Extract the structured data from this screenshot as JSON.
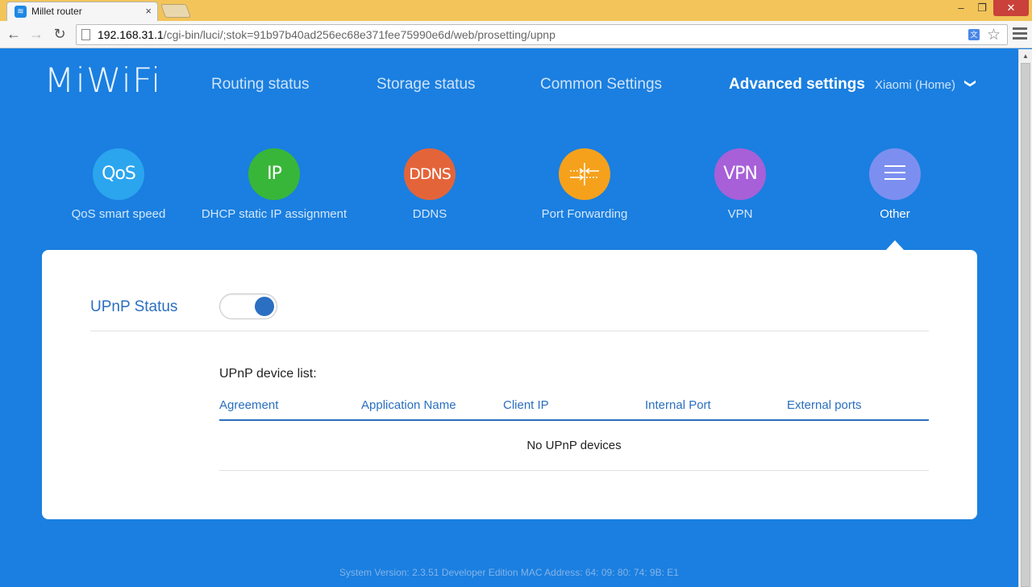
{
  "browser": {
    "tab_title": "Millet router",
    "tab_close": "×",
    "url_host": "192.168.31.1",
    "url_path": "/cgi-bin/luci/;stok=91b97b40ad256ec68e371fee75990e6d/web/prosetting/upnp",
    "window_minimize": "–",
    "window_maximize": "❐",
    "window_close": "✕",
    "back": "←",
    "forward": "→",
    "reload": "↻",
    "star": "☆"
  },
  "header": {
    "logo": "MiWiFi",
    "nav": {
      "routing": "Routing status",
      "storage": "Storage status",
      "common": "Common Settings",
      "advanced": "Advanced settings"
    },
    "router_name": "Xiaomi (Home)",
    "chevron": "❯"
  },
  "features": {
    "qos": {
      "icon_text": "QoS",
      "label": "QoS smart speed"
    },
    "ip": {
      "icon_text": "IP",
      "label": "DHCP static IP assignment"
    },
    "ddns": {
      "icon_text": "DDNS",
      "label": "DDNS"
    },
    "port_forwarding": {
      "label": "Port Forwarding"
    },
    "vpn": {
      "icon_text": "VPN",
      "label": "VPN"
    },
    "other": {
      "label": "Other"
    }
  },
  "upnp": {
    "status_label": "UPnP Status",
    "enabled": true,
    "device_list_title": "UPnP device list:",
    "columns": {
      "agreement": "Agreement",
      "application_name": "Application Name",
      "client_ip": "Client IP",
      "internal_port": "Internal Port",
      "external_ports": "External ports"
    },
    "empty_text": "No UPnP devices"
  },
  "footer": {
    "text": "System Version: 2.3.51 Developer Edition MAC Address: 64: 09: 80: 74: 9B: E1"
  },
  "colors": {
    "page_bg": "#1a7fe0",
    "accent": "#2a6fc0",
    "qos": "#2ba5ee",
    "ip": "#38b639",
    "ddns": "#e4643a",
    "port_forwarding": "#f5a11c",
    "vpn": "#a760d8",
    "other": "#7c8ff0"
  }
}
